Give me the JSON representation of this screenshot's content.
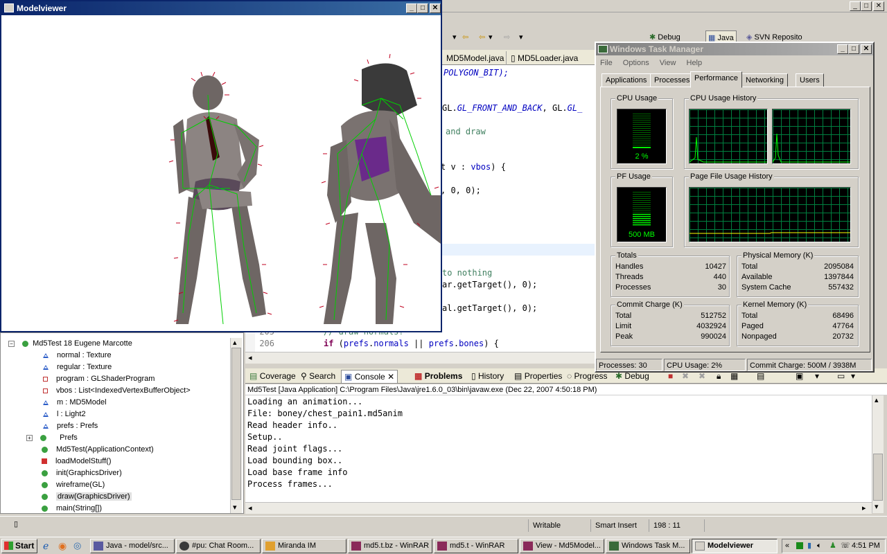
{
  "modelviewer": {
    "title": "Modelviewer"
  },
  "eclipse": {
    "perspectives": [
      "Debug",
      "Java",
      "SVN Reposito"
    ],
    "editor_tabs": [
      "MD5Model.java",
      "MD5Loader.java"
    ],
    "code_lines": {
      "l1": "POLYGON_BIT);",
      "l2a": "GL.",
      "l2b": "GL_FRONT_AND_BACK",
      "l2c": ", GL.",
      "l2d": "GL_",
      "l3": "and draw",
      "l4a": "t v : ",
      "l4b": "vbos",
      "l4c": ") {",
      "l5": ", 0, 0);",
      "l6": "to nothing",
      "l7": "ar.getTarget(), 0);",
      "l8": "al.getTarget(), 0);",
      "l9": "// draw normals?",
      "l10a": "if",
      "l10b": " (",
      "l10c": "prefs",
      "l10d": ".",
      "l10e": "normals",
      "l10f": " || ",
      "l10g": "prefs",
      "l10h": ".",
      "l10i": "bones",
      "l10j": ") {"
    },
    "line_numbers": [
      "205",
      "206"
    ],
    "outline": {
      "root": "Md5Test 18  Eugene Marcotte",
      "items": [
        "normal : Texture",
        "regular : Texture",
        "program : GLShaderProgram",
        "vbos : List<IndexedVertexBufferObject>",
        "m : MD5Model",
        "l : Light2",
        "prefs : Prefs",
        "Prefs",
        "Md5Test(ApplicationContext)",
        "loadModelStuff()",
        "init(GraphicsDriver)",
        "wireframe(GL)",
        "draw(GraphicsDriver)",
        "main(String[])"
      ]
    },
    "bottom_tabs": [
      "Coverage",
      "Search",
      "Console",
      "Problems",
      "History",
      "Properties",
      "Progress",
      "Debug"
    ],
    "console_header": "Md5Test [Java Application] C:\\Program Files\\Java\\jre1.6.0_03\\bin\\javaw.exe (Dec 22, 2007 4:50:18 PM)",
    "console_lines": [
      "Loading an animation...",
      "File: boney/chest_pain1.md5anim",
      "Read header info..",
      "Setup..",
      "Read joint flags...",
      "Load bounding box..",
      "Load base frame info",
      "Process frames..."
    ],
    "status": {
      "writable": "Writable",
      "insert": "Smart Insert",
      "position": "198 : 11"
    }
  },
  "taskmgr": {
    "title": "Windows Task Manager",
    "menu": [
      "File",
      "Options",
      "View",
      "Help"
    ],
    "tabs": [
      "Applications",
      "Processes",
      "Performance",
      "Networking",
      "Users"
    ],
    "cpu_usage_label": "CPU Usage",
    "cpu_usage_value": "2 %",
    "cpu_history_label": "CPU Usage History",
    "pf_usage_label": "PF Usage",
    "pf_usage_value": "500 MB",
    "pf_history_label": "Page File Usage History",
    "totals": {
      "label": "Totals",
      "rows": [
        [
          "Handles",
          "10427"
        ],
        [
          "Threads",
          "440"
        ],
        [
          "Processes",
          "30"
        ]
      ]
    },
    "physical": {
      "label": "Physical Memory (K)",
      "rows": [
        [
          "Total",
          "2095084"
        ],
        [
          "Available",
          "1397844"
        ],
        [
          "System Cache",
          "557432"
        ]
      ]
    },
    "commit": {
      "label": "Commit Charge (K)",
      "rows": [
        [
          "Total",
          "512752"
        ],
        [
          "Limit",
          "4032924"
        ],
        [
          "Peak",
          "990024"
        ]
      ]
    },
    "kernel": {
      "label": "Kernel Memory (K)",
      "rows": [
        [
          "Total",
          "68496"
        ],
        [
          "Paged",
          "47764"
        ],
        [
          "Nonpaged",
          "20732"
        ]
      ]
    },
    "status": {
      "processes": "Processes: 30",
      "cpu": "CPU Usage: 2%",
      "commit": "Commit Charge: 500M / 3938M"
    }
  },
  "taskbar": {
    "start": "Start",
    "tasks": [
      "Java - model/src...",
      "#pu: Chat Room...",
      "Miranda IM",
      "md5.t.bz - WinRAR",
      "md5.t - WinRAR",
      "View - Md5Model...",
      "Windows Task M...",
      "Modelviewer"
    ],
    "clock": "4:51 PM"
  }
}
